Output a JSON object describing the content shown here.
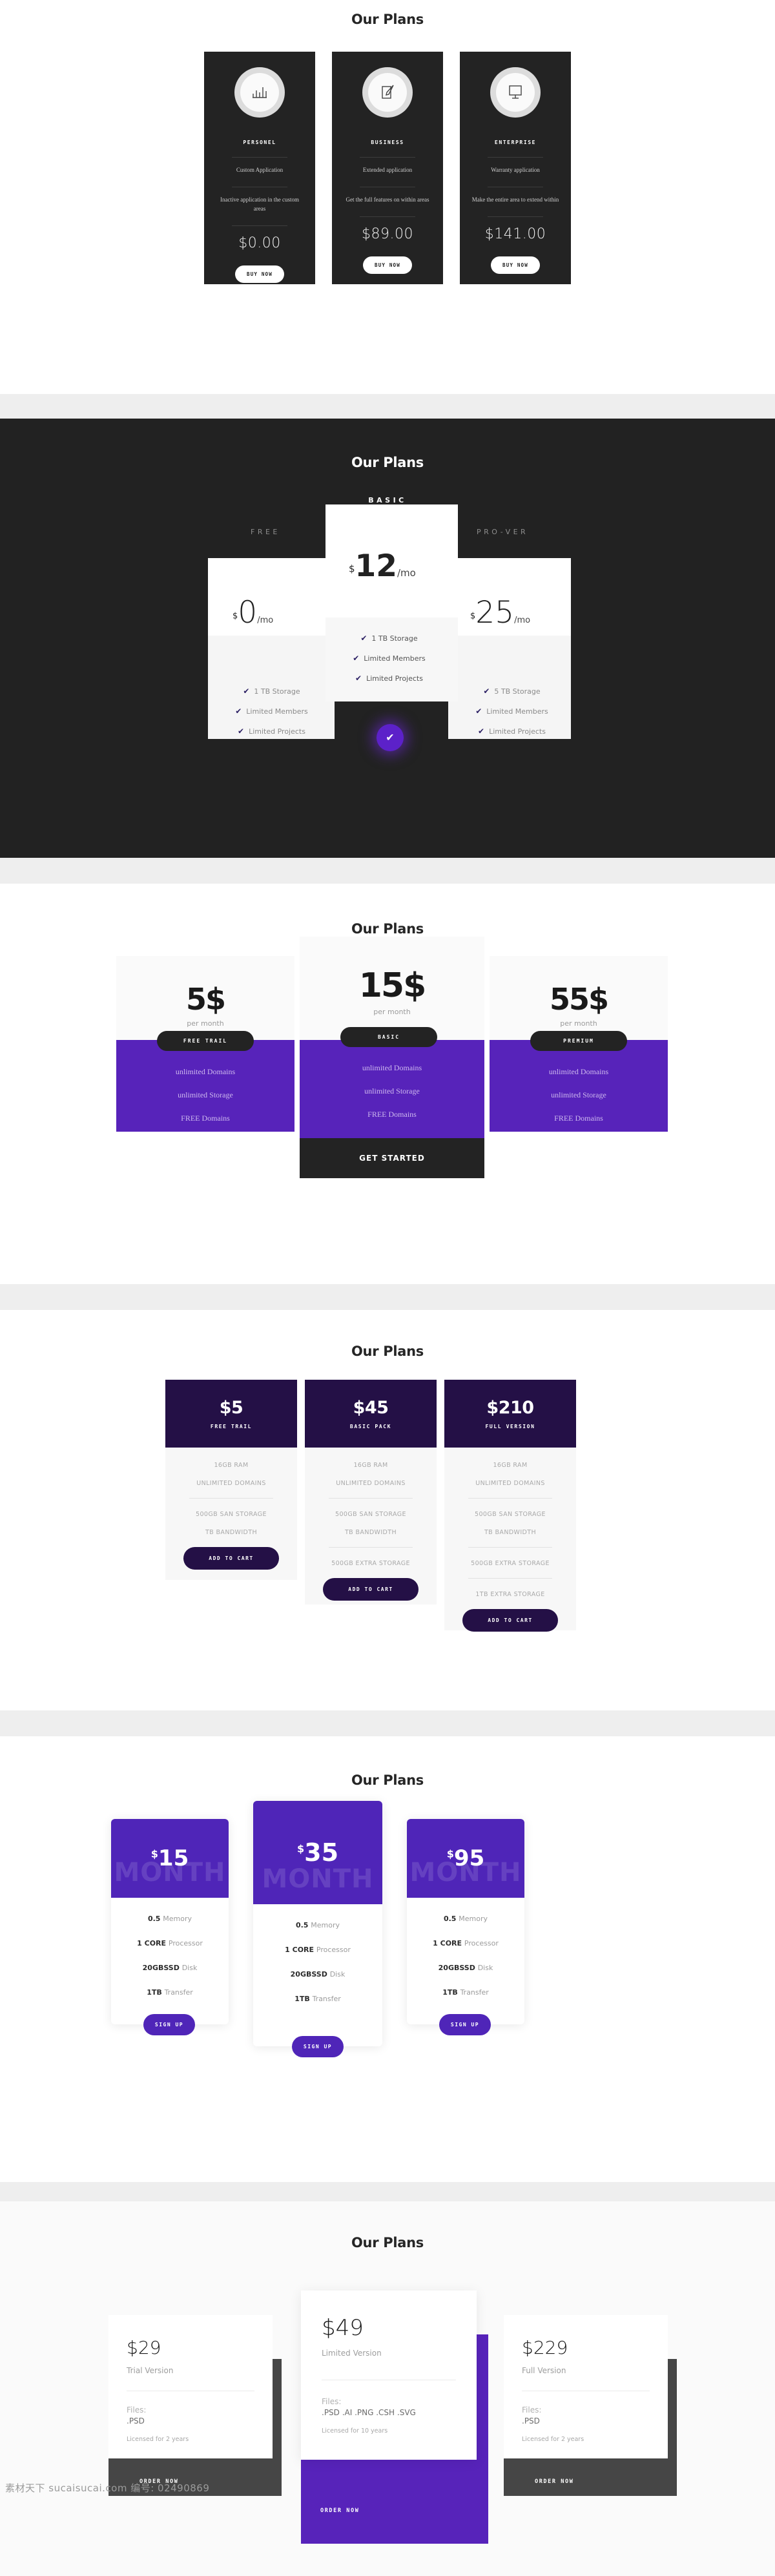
{
  "watermark": "素材天下 sucaisucai.com  编号: 02490869",
  "colors": {
    "dark": "#232323",
    "purple": "#5723ba",
    "purple_bright": "#4f25b8",
    "navy": "#241046",
    "grey_bg": "#eeeeee"
  },
  "section1": {
    "title": "Our Plans",
    "cards": [
      {
        "icon": "bar-chart-icon",
        "plan": "PERSONEL",
        "feature1": "Custom Application",
        "feature2": "Inactive application in the custom areas",
        "price": "$0.00",
        "cta": "BUY NOW"
      },
      {
        "icon": "pencil-document-icon",
        "plan": "BUSINESS",
        "feature1": "Extended application",
        "feature2": "Get the full features on within areas",
        "price": "$89.00",
        "cta": "BUY NOW"
      },
      {
        "icon": "monitor-icon",
        "plan": "ENTERPRISE",
        "feature1": "Warranty application",
        "feature2": "Make the entire area to extend within",
        "price": "$141.00",
        "cta": "BUY NOW"
      }
    ]
  },
  "section2": {
    "title": "Our Plans",
    "featured_label": "BASIC",
    "left_label": "FREE",
    "right_label": "PRO-VER",
    "confirm_icon": "check-icon",
    "plans": [
      {
        "currency": "$",
        "amount": "0",
        "period": "/mo",
        "features": [
          "1 TB Storage",
          "Limited Members",
          "Limited Projects"
        ]
      },
      {
        "currency": "$",
        "amount": "12",
        "period": "/mo",
        "features": [
          "1 TB Storage",
          "Limited Members",
          "Limited Projects"
        ]
      },
      {
        "currency": "$",
        "amount": "25",
        "period": "/mo",
        "features": [
          "5 TB Storage",
          "Limited Members",
          "Limited Projects"
        ]
      }
    ]
  },
  "section3": {
    "title": "Our Plans",
    "cards": [
      {
        "price": "5$",
        "per": "per month",
        "badge": "FREE TRAIL",
        "features": [
          "unlimited Domains",
          "unlimited Storage",
          "FREE Domains"
        ]
      },
      {
        "price": "15$",
        "per": "per month",
        "badge": "BASIC",
        "features": [
          "unlimited Domains",
          "unlimited Storage",
          "FREE Domains"
        ],
        "cta": "GET STARTED"
      },
      {
        "price": "55$",
        "per": "per month",
        "badge": "PREMIUM",
        "features": [
          "unlimited Domains",
          "unlimited Storage",
          "FREE Domains"
        ]
      }
    ]
  },
  "section4": {
    "title": "Our Plans",
    "cards": [
      {
        "price": "$5",
        "plan": "FREE TRAIL",
        "group1": [
          "16GB RAM",
          "UNLIMITED DOMAINS"
        ],
        "group2": [
          "500GB SAN STORAGE",
          "TB BANDWIDTH"
        ],
        "group3": [],
        "cta": "ADD TO CART"
      },
      {
        "price": "$45",
        "plan": "BASIC PACK",
        "group1": [
          "16GB RAM",
          "UNLIMITED DOMAINS"
        ],
        "group2": [
          "500GB SAN STORAGE",
          "TB BANDWIDTH"
        ],
        "group3": [
          "500GB EXTRA STORAGE"
        ],
        "cta": "ADD TO CART"
      },
      {
        "price": "$210",
        "plan": "FULL VERSION",
        "group1": [
          "16GB RAM",
          "UNLIMITED DOMAINS"
        ],
        "group2": [
          "500GB SAN STORAGE",
          "TB BANDWIDTH"
        ],
        "group3": [
          "500GB EXTRA STORAGE"
        ],
        "group4": [
          "1TB EXTRA STORAGE"
        ],
        "cta": "ADD TO CART"
      }
    ]
  },
  "section5": {
    "title": "Our Plans",
    "watermark_word": "MONTH",
    "cards": [
      {
        "currency": "$",
        "amount": "15",
        "features": [
          [
            "0.5 ",
            "Memory"
          ],
          [
            "1 CORE ",
            "Processor"
          ],
          [
            "20GBSSD ",
            "Disk"
          ],
          [
            "1TB ",
            "Transfer"
          ]
        ],
        "cta": "SIGN UP"
      },
      {
        "currency": "$",
        "amount": "35",
        "features": [
          [
            "0.5 ",
            "Memory"
          ],
          [
            "1 CORE ",
            "Processor"
          ],
          [
            "20GBSSD ",
            "Disk"
          ],
          [
            "1TB ",
            "Transfer"
          ]
        ],
        "cta": "SIGN UP"
      },
      {
        "currency": "$",
        "amount": "95",
        "features": [
          [
            "0.5 ",
            "Memory"
          ],
          [
            "1 CORE ",
            "Processor"
          ],
          [
            "20GBSSD ",
            "Disk"
          ],
          [
            "1TB ",
            "Transfer"
          ]
        ],
        "cta": "SIGN UP"
      }
    ]
  },
  "section6": {
    "title": "Our Plans",
    "files_label": "Files:",
    "cards": [
      {
        "price": "$29",
        "version": "Trial Version",
        "files": ".PSD",
        "license": "Licensed for 2 years",
        "cta": "ORDER NOW"
      },
      {
        "price": "$49",
        "version": "Limited Version",
        "files": ".PSD .AI .PNG .CSH .SVG",
        "license": "Licensed for 10 years",
        "cta": "ORDER NOW"
      },
      {
        "price": "$229",
        "version": "Full Version",
        "files": ".PSD",
        "license": "Licensed for 2 years",
        "cta": "ORDER NOW"
      }
    ]
  }
}
